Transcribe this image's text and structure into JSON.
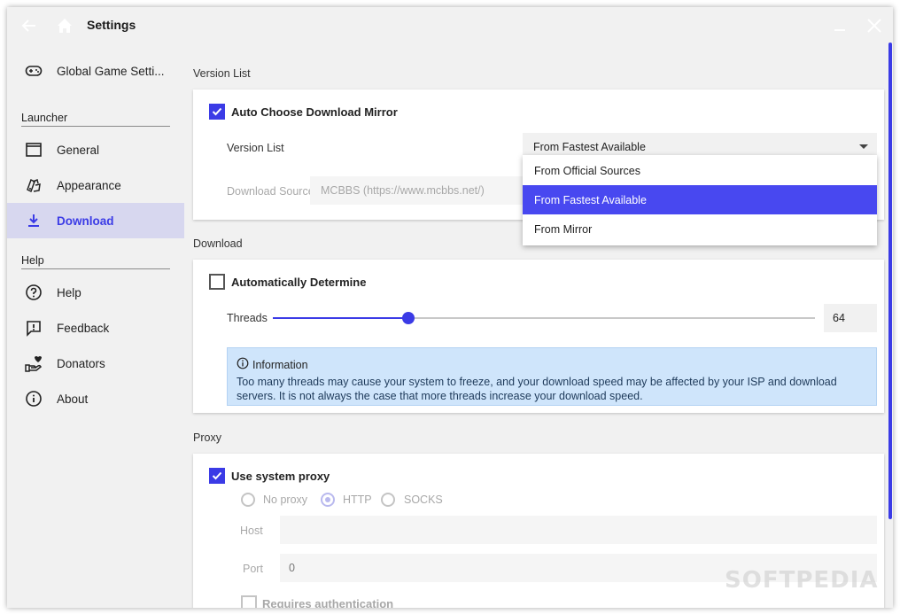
{
  "titlebar": {
    "title": "Settings"
  },
  "sidebar": {
    "global": "Global Game Setti...",
    "launcher_section": "Launcher",
    "launcher_items": [
      {
        "label": "General",
        "icon": "window-icon"
      },
      {
        "label": "Appearance",
        "icon": "palette-icon"
      },
      {
        "label": "Download",
        "icon": "download-icon"
      }
    ],
    "help_section": "Help",
    "help_items": [
      {
        "label": "Help",
        "icon": "question-icon"
      },
      {
        "label": "Feedback",
        "icon": "feedback-icon"
      },
      {
        "label": "Donators",
        "icon": "donate-icon"
      },
      {
        "label": "About",
        "icon": "info-icon"
      }
    ]
  },
  "version_list": {
    "section": "Version List",
    "auto_mirror_label": "Auto Choose Download Mirror",
    "auto_mirror_checked": true,
    "version_list_label": "Version List",
    "version_list_value": "From Fastest Available",
    "source_label": "Download Source",
    "source_value": "MCBBS (https://www.mcbbs.net/)",
    "options": [
      "From Official Sources",
      "From Fastest Available",
      "From Mirror"
    ],
    "selected_option": "From Fastest Available"
  },
  "download": {
    "section": "Download",
    "auto_label": "Automatically Determine",
    "auto_checked": false,
    "threads_label": "Threads",
    "threads_value": "64",
    "slider_fraction": 0.25,
    "info_title": "Information",
    "info_body": "Too many threads may cause your system to freeze, and your download speed may be affected by your ISP and download servers. It is not always the case that more threads increase your download speed."
  },
  "proxy": {
    "section": "Proxy",
    "system_label": "Use system proxy",
    "system_checked": true,
    "radio_none": "No proxy",
    "radio_http": "HTTP",
    "radio_socks": "SOCKS",
    "selected": "HTTP",
    "host_label": "Host",
    "host_value": "",
    "port_label": "Port",
    "port_value": "0",
    "auth_label": "Requires authentication"
  },
  "watermark": "SOFTPEDIA",
  "colors": {
    "accent": "#3b3be6",
    "active_bg": "#d7d7ef",
    "info_bg": "#cfe5fb"
  }
}
